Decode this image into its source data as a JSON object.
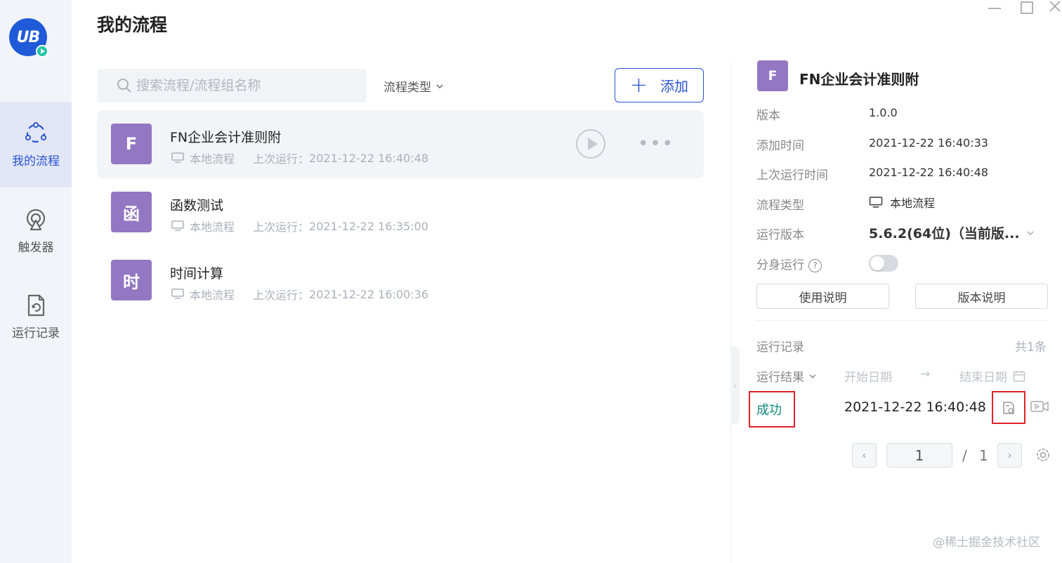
{
  "app": {
    "logo_text": "UB"
  },
  "sidebar": {
    "items": [
      {
        "label": "我的流程",
        "icon": "flow-nodes-icon",
        "active": true
      },
      {
        "label": "触发器",
        "icon": "trigger-icon",
        "active": false
      },
      {
        "label": "运行记录",
        "icon": "run-log-icon",
        "active": false
      }
    ]
  },
  "main": {
    "title": "我的流程",
    "search_placeholder": "搜索流程/流程组名称",
    "filter_label": "流程类型",
    "add_label": "添加",
    "flows": [
      {
        "avatar": "F",
        "name": "FN企业会计准则附",
        "type": "本地流程",
        "last_run_label": "上次运行：",
        "last_run": "2021-12-22 16:40:48",
        "active": true
      },
      {
        "avatar": "函",
        "name": "函数测试",
        "type": "本地流程",
        "last_run_label": "上次运行：",
        "last_run": "2021-12-22 16:35:00",
        "active": false
      },
      {
        "avatar": "时",
        "name": "时间计算",
        "type": "本地流程",
        "last_run_label": "上次运行：",
        "last_run": "2021-12-22 16:00:36",
        "active": false
      }
    ]
  },
  "detail": {
    "avatar": "F",
    "title": "FN企业会计准则附",
    "rows": {
      "version_label": "版本",
      "version": "1.0.0",
      "added_label": "添加时间",
      "added": "2021-12-22 16:40:33",
      "last_run_label": "上次运行时间",
      "last_run": "2021-12-22 16:40:48",
      "type_label": "流程类型",
      "type": "本地流程",
      "runtime_label": "运行版本",
      "runtime": "5.6.2(64位)（当前版...",
      "clone_label": "分身运行",
      "clone_enabled": false
    },
    "buttons": {
      "usage": "使用说明",
      "release_notes": "版本说明"
    },
    "records": {
      "title": "运行记录",
      "count": "共1条",
      "result_filter": "运行结果",
      "start_date": "开始日期",
      "arrow": "→",
      "end_date": "结束日期",
      "items": [
        {
          "status": "成功",
          "time": "2021-12-22 16:40:48"
        }
      ]
    },
    "pager": {
      "current": "1",
      "separator": "/",
      "total": "1"
    }
  },
  "colors": {
    "accent": "#2a54d4",
    "avatar": "#9377c2",
    "success": "#0f8a7a",
    "highlight": "#e0212a"
  },
  "watermark": "@稀土掘金技术社区"
}
